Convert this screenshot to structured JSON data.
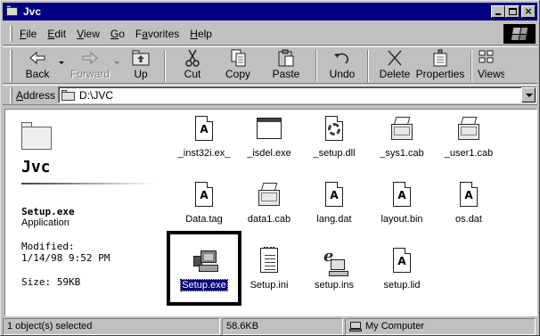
{
  "window": {
    "title": "Jvc"
  },
  "title_buttons": {
    "minimize": "_",
    "maximize": "□",
    "close": "×"
  },
  "menu": {
    "items": [
      {
        "key": "F",
        "rest": "ile"
      },
      {
        "key": "E",
        "rest": "dit"
      },
      {
        "key": "V",
        "rest": "iew"
      },
      {
        "key": "G",
        "rest": "o"
      },
      {
        "key": "F",
        "rest": "avorites",
        "prefix": ""
      },
      {
        "key": "H",
        "rest": "elp"
      }
    ]
  },
  "toolbar": {
    "back": "Back",
    "forward": "Forward",
    "up": "Up",
    "cut": "Cut",
    "copy": "Copy",
    "paste": "Paste",
    "undo": "Undo",
    "delete": "Delete",
    "properties": "Properties",
    "views": "Views"
  },
  "address": {
    "label_key": "A",
    "label_rest": "ddress",
    "value": "D:\\JVC"
  },
  "left_panel": {
    "folder_name": "Jvc",
    "selected_name": "Setup.exe",
    "selected_type": "Application",
    "modified_label": "Modified:",
    "modified_value": "1/14/98 9:52 PM",
    "size": "Size: 59KB"
  },
  "files": [
    {
      "name": "_inst32i.ex_",
      "icon": "document-a-icon"
    },
    {
      "name": "_isdel.exe",
      "icon": "window-app-icon"
    },
    {
      "name": "_setup.dll",
      "icon": "dll-gear-icon"
    },
    {
      "name": "_sys1.cab",
      "icon": "cab-icon"
    },
    {
      "name": "_user1.cab",
      "icon": "cab-icon"
    },
    {
      "name": "Data.tag",
      "icon": "document-a-icon"
    },
    {
      "name": "data1.cab",
      "icon": "cab-icon"
    },
    {
      "name": "lang.dat",
      "icon": "document-a-icon"
    },
    {
      "name": "layout.bin",
      "icon": "document-a-icon"
    },
    {
      "name": "os.dat",
      "icon": "document-a-icon"
    },
    {
      "name": "Setup.exe",
      "icon": "setup-computer-icon",
      "selected": true
    },
    {
      "name": "Setup.ini",
      "icon": "ini-notepad-icon"
    },
    {
      "name": "setup.ins",
      "icon": "ins-script-icon"
    },
    {
      "name": "setup.lid",
      "icon": "document-a-icon"
    }
  ],
  "status": {
    "selection": "1 object(s) selected",
    "size": "58.6KB",
    "location": "My Computer"
  }
}
